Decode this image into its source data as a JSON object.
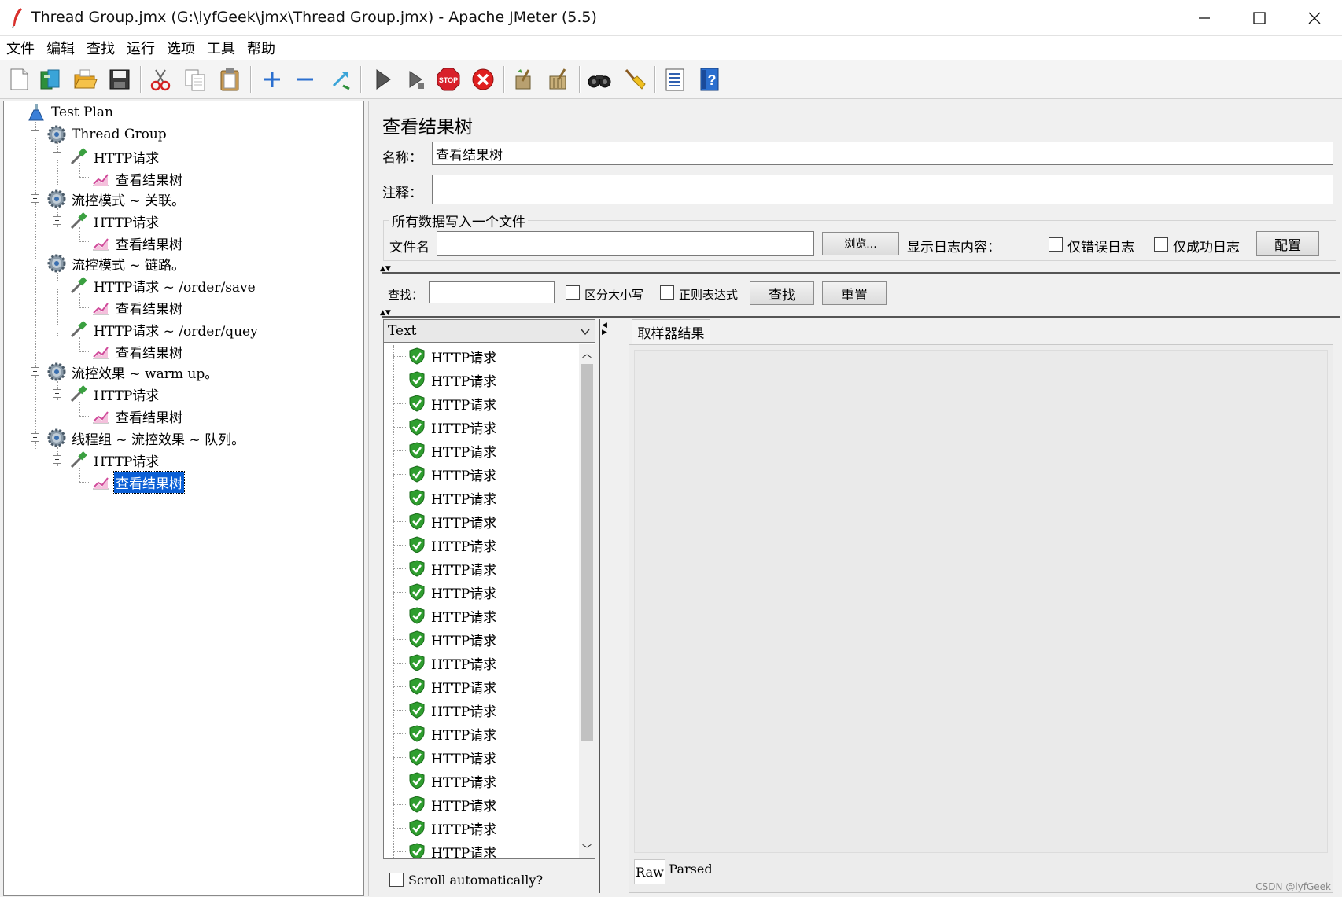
{
  "window": {
    "title": "Thread Group.jmx (G:\\lyfGeek\\jmx\\Thread Group.jmx) - Apache JMeter (5.5)"
  },
  "menu": [
    "文件",
    "编辑",
    "查找",
    "运行",
    "选项",
    "工具",
    "帮助"
  ],
  "toolbar_icons": [
    "new-icon",
    "templates-icon",
    "open-icon",
    "save-icon",
    "cut-icon",
    "copy-icon",
    "paste-icon",
    "expand-icon",
    "collapse-icon",
    "toggle-icon",
    "start-icon",
    "start-no-timers-icon",
    "stop-icon",
    "shutdown-icon",
    "clear-icon",
    "clear-all-icon",
    "search-icon",
    "reset-search-icon",
    "function-helper-icon",
    "help-icon"
  ],
  "tree": {
    "test_plan": "Test Plan",
    "thread_group": "Thread Group",
    "http_request": "HTTP请求",
    "view_results_tree": "查看结果树",
    "flow_association": "流控模式 ~ 关联。",
    "flow_chain": "流控模式 ~ 链路。",
    "http_save": "HTTP请求 ~ /order/save",
    "http_query": "HTTP请求 ~ /order/quey",
    "flow_warmup": "流控效果 ~ warm up。",
    "thread_queue": "线程组 ~ 流控效果 ~ 队列。"
  },
  "panel": {
    "title": "查看结果树",
    "name_label": "名称：",
    "name_value": "查看结果树",
    "comment_label": "注释：",
    "comment_value": "",
    "file_group_title": "所有数据写入一个文件",
    "filename_label": "文件名",
    "filename_value": "",
    "browse_button": "浏览...",
    "log_content_label": "显示日志内容：",
    "errors_only_label": "仅错误日志",
    "success_only_label": "仅成功日志",
    "configure_button": "配置",
    "search_label": "查找：",
    "search_value": "",
    "case_sensitive_label": "区分大小写",
    "regex_label": "正则表达式",
    "search_button": "查找",
    "reset_button": "重置",
    "renderer_value": "Text",
    "sampler_result_tab": "取样器结果",
    "result_item_label": "HTTP请求",
    "result_count": 22,
    "scroll_auto_label": "Scroll automatically?",
    "raw_tab": "Raw",
    "parsed_tab": "Parsed"
  },
  "watermark": "CSDN @lyfGeek",
  "colors": {
    "selection": "#0a5fd6",
    "success_shield": "#2f9e2f"
  }
}
